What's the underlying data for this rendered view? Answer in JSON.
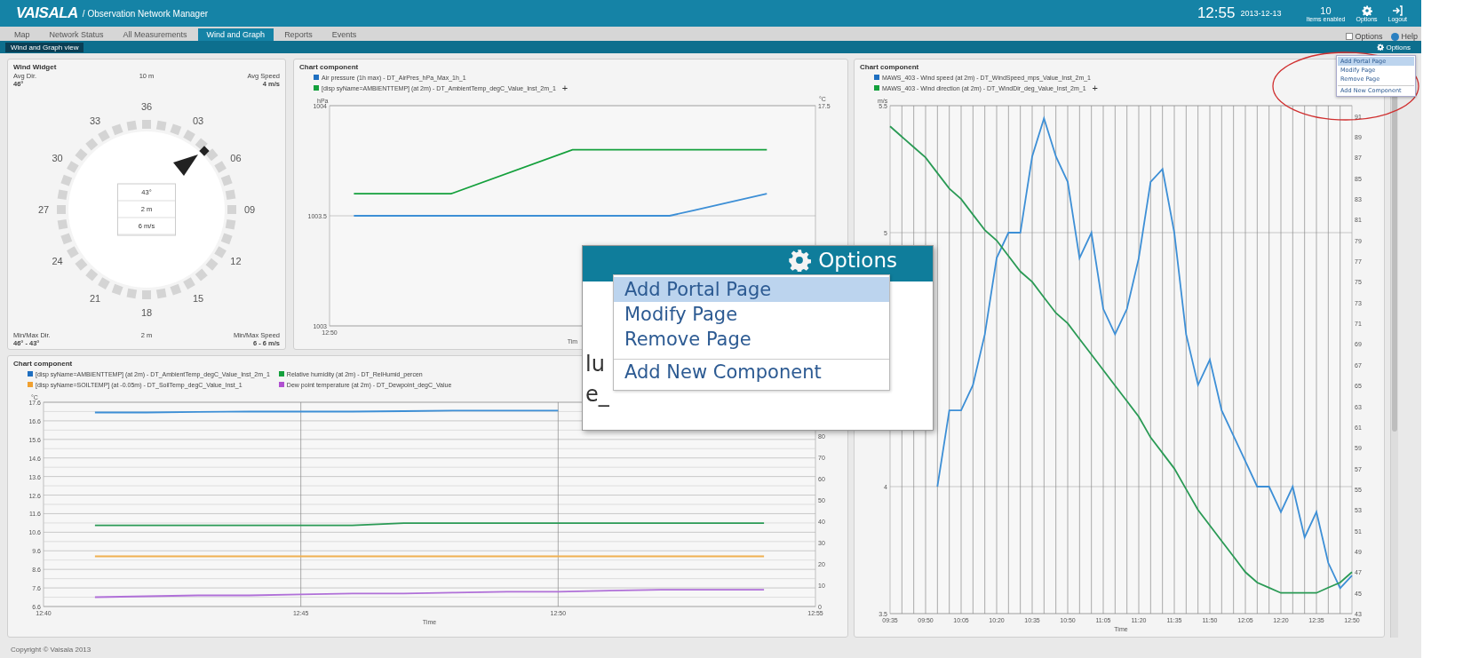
{
  "header": {
    "logo": "VAISALA",
    "app_title": "/ Observation Network Manager",
    "time": "12:55",
    "date": "2013-12-13",
    "actions": [
      {
        "kind": "count",
        "value": "10",
        "label": "Items enabled"
      },
      {
        "kind": "gear",
        "label": "Options"
      },
      {
        "kind": "logout",
        "label": "Logout"
      }
    ]
  },
  "tabs": [
    {
      "label": "Map",
      "selected": false
    },
    {
      "label": "Network Status",
      "selected": false
    },
    {
      "label": "All Measurements",
      "selected": false
    },
    {
      "label": "Wind and Graph",
      "selected": true
    },
    {
      "label": "Reports",
      "selected": false
    },
    {
      "label": "Events",
      "selected": false
    }
  ],
  "tab_links": [
    {
      "kind": "options",
      "label": "Options"
    },
    {
      "kind": "help",
      "label": "Help"
    }
  ],
  "sub_tabs": [
    {
      "label": "Wind and Graph view",
      "selected": true
    }
  ],
  "sub_options": "Options",
  "options_menu": {
    "items": [
      {
        "label": "Add Portal Page",
        "selected": true,
        "separated": false
      },
      {
        "label": "Modify Page",
        "selected": false,
        "separated": false
      },
      {
        "label": "Remove Page",
        "selected": false,
        "separated": false
      },
      {
        "label": "Add New Component",
        "selected": false,
        "separated": true
      }
    ]
  },
  "wind_widget": {
    "title": "Wind Widget",
    "top": {
      "left_label": "Avg Dir.",
      "mid_label": "10 m",
      "right_label": "Avg Speed",
      "left_value": "46°",
      "right_value": "4 m/s"
    },
    "compass": [
      "36",
      "03",
      "06",
      "09",
      "12",
      "15",
      "18",
      "21",
      "24",
      "27",
      "30",
      "33"
    ],
    "center": [
      "43°",
      "2 m",
      "6 m/s"
    ],
    "bottom": {
      "left_label": "Min/Max Dir.",
      "mid_label": "2 m",
      "right_label": "Min/Max Speed",
      "left_value": "46° - 43°",
      "right_value": "6 - 6 m/s"
    }
  },
  "top_chart": {
    "title": "Chart component",
    "add": "+",
    "legend": [
      {
        "color": "#1f6fc0",
        "text": "Air pressure (1h max) - DT_AirPres_hPa_Max_1h_1"
      },
      {
        "color": "#14a03c",
        "text": "[disp syName=AMBIENTTEMP] (at 2m) - DT_AmbientTemp_degC_Value_Inst_2m_1"
      }
    ],
    "right_axis": {
      "unit": "°C",
      "top_label": "17.5"
    },
    "x_start_label": "12:50",
    "chart_data": {
      "type": "line",
      "grid": true,
      "xlabel": "Tim",
      "ylabel": "hPa",
      "ylim": [
        1003,
        1004
      ],
      "yticks": [
        {
          "value": 1003,
          "label": "1003"
        },
        {
          "value": 1003.5,
          "label": "1003.5"
        },
        {
          "value": 1004,
          "label": "1004"
        }
      ],
      "series": [
        {
          "color": "#3d8fd6",
          "values": [
            null,
            1003.5,
            1003.5,
            1003.5,
            1003.5,
            1003.5,
            1003.5,
            1003.5,
            1003.5,
            1003.5,
            1003.5,
            1003.5,
            1003.5,
            1003.5,
            1003.5,
            1003.525,
            1003.55,
            1003.575,
            1003.6,
            null,
            null
          ]
        }
      ]
    }
  },
  "bottom_chart": {
    "title": "Chart component",
    "legend": [
      {
        "color": "#1f6fc0",
        "text": "[disp syName=AMBIENTTEMP] (at 2m) - DT_AmbientTemp_degC_Value_Inst_2m_1"
      },
      {
        "color": "#14a03c",
        "text": "Relative humidity (at 2m) - DT_RelHumid_percen"
      },
      {
        "color": "#f0a030",
        "text": "[disp syName=SOILTEMP] (at -0.05m) - DT_SoilTemp_degC_Value_Inst_1"
      },
      {
        "color": "#b050d0",
        "text": "Dew point temperature (at 2m) - DT_Dewpoint_degC_Value"
      }
    ],
    "chart_data": {
      "type": "line",
      "grid": true,
      "xlabel": "Time",
      "ylabel": "°C",
      "categories": [
        "12:40",
        null,
        null,
        null,
        null,
        "12:45",
        null,
        null,
        null,
        null,
        "12:50",
        null,
        null,
        null,
        null,
        "12:55"
      ],
      "ylim": [
        6.6,
        17.6
      ],
      "yticks": [
        {
          "value": 6.6,
          "label": "6.6"
        },
        {
          "value": 7.6,
          "label": "7.6"
        },
        {
          "value": 8.6,
          "label": "8.6"
        },
        {
          "value": 9.6,
          "label": "9.6"
        },
        {
          "value": 10.6,
          "label": "10.6"
        },
        {
          "value": 11.6,
          "label": "11.6"
        },
        {
          "value": 12.6,
          "label": "12.6"
        },
        {
          "value": 13.6,
          "label": "13.6"
        },
        {
          "value": 14.6,
          "label": "14.6"
        },
        {
          "value": 15.6,
          "label": "15.6"
        },
        {
          "value": 16.6,
          "label": "16.6"
        },
        {
          "value": 17.6,
          "label": "17.6"
        }
      ],
      "y2lim": [
        0,
        95.6
      ],
      "y2ticks": [
        {
          "value": 0,
          "label": "0"
        },
        {
          "value": 10,
          "label": "10"
        },
        {
          "value": 20,
          "label": "20"
        },
        {
          "value": 30,
          "label": "30"
        },
        {
          "value": 40,
          "label": "40"
        },
        {
          "value": 50,
          "label": "50"
        },
        {
          "value": 60,
          "label": "60"
        },
        {
          "value": 70,
          "label": "70"
        },
        {
          "value": 80,
          "label": "80"
        }
      ],
      "series": [
        {
          "color": "#3d8fd6",
          "values": [
            null,
            17.05,
            17.05,
            17.08,
            17.1,
            17.1,
            17.1,
            17.12,
            17.15,
            17.15,
            17.15,
            null,
            null,
            null,
            null,
            null
          ]
        },
        {
          "color": "#2a9a55",
          "axis": "y2",
          "values": [
            null,
            38,
            38,
            38,
            38,
            38,
            38,
            39,
            39,
            39,
            39,
            39,
            39,
            39,
            39,
            null
          ]
        },
        {
          "color": "#f0b050",
          "values": [
            null,
            9.3,
            9.3,
            9.3,
            9.3,
            9.3,
            9.3,
            9.3,
            9.3,
            9.3,
            9.3,
            9.3,
            9.3,
            9.3,
            9.3,
            null
          ]
        },
        {
          "color": "#b070d8",
          "values": [
            null,
            7.1,
            7.15,
            7.2,
            7.2,
            7.25,
            7.3,
            7.3,
            7.35,
            7.4,
            7.4,
            7.45,
            7.5,
            7.5,
            7.5,
            null
          ]
        }
      ]
    }
  },
  "right_chart": {
    "title": "Chart component",
    "add": "+",
    "legend": [
      {
        "color": "#1f6fc0",
        "text": "MAWS_403 - Wind speed (at 2m) - DT_WindSpeed_mps_Value_Inst_2m_1"
      },
      {
        "color": "#14a03c",
        "text": "MAWS_403 - Wind direction (at 2m) - DT_WindDir_deg_Value_Inst_2m_1"
      }
    ],
    "chart_data": {
      "type": "line",
      "grid": true,
      "xlabel": "Time",
      "ylabel": "m/s",
      "categories": [
        "09:35",
        null,
        null,
        "09:50",
        null,
        null,
        "10:05",
        null,
        null,
        "10:20",
        null,
        null,
        "10:35",
        null,
        null,
        "10:50",
        null,
        null,
        "11:05",
        null,
        null,
        "11:20",
        null,
        null,
        "11:35",
        null,
        null,
        "11:50",
        null,
        null,
        "12:05",
        null,
        null,
        "12:20",
        null,
        null,
        "12:35",
        null,
        null,
        "12:50"
      ],
      "ylim": [
        3.5,
        5.5
      ],
      "yticks": [
        {
          "value": 3.5,
          "label": "3.5"
        },
        {
          "value": 4,
          "label": "4"
        },
        {
          "value": 5,
          "label": "5"
        },
        {
          "value": 5.5,
          "label": "5.5"
        }
      ],
      "y2lim": [
        43,
        92
      ],
      "y2ticks": [
        {
          "value": 43,
          "label": "43"
        },
        {
          "value": 45,
          "label": "45"
        },
        {
          "value": 47,
          "label": "47"
        },
        {
          "value": 49,
          "label": "49"
        },
        {
          "value": 51,
          "label": "51"
        },
        {
          "value": 53,
          "label": "53"
        },
        {
          "value": 55,
          "label": "55"
        },
        {
          "value": 57,
          "label": "57"
        },
        {
          "value": 59,
          "label": "59"
        },
        {
          "value": 61,
          "label": "61"
        },
        {
          "value": 63,
          "label": "63"
        },
        {
          "value": 65,
          "label": "65"
        },
        {
          "value": 67,
          "label": "67"
        },
        {
          "value": 69,
          "label": "69"
        },
        {
          "value": 71,
          "label": "71"
        },
        {
          "value": 73,
          "label": "73"
        },
        {
          "value": 75,
          "label": "75"
        },
        {
          "value": 77,
          "label": "77"
        },
        {
          "value": 79,
          "label": "79"
        },
        {
          "value": 81,
          "label": "81"
        },
        {
          "value": 83,
          "label": "83"
        },
        {
          "value": 85,
          "label": "85"
        },
        {
          "value": 87,
          "label": "87"
        },
        {
          "value": 89,
          "label": "89"
        },
        {
          "value": 91,
          "label": "91"
        }
      ],
      "series": [
        {
          "color": "#3d8fd6",
          "values": [
            null,
            null,
            null,
            null,
            4.0,
            4.3,
            4.3,
            4.4,
            4.6,
            4.9,
            5.0,
            5.0,
            5.3,
            5.45,
            5.3,
            5.2,
            4.9,
            5.0,
            4.7,
            4.6,
            4.7,
            4.9,
            5.2,
            5.25,
            5.0,
            4.6,
            4.4,
            4.5,
            4.3,
            4.2,
            4.1,
            4.0,
            4.0,
            3.9,
            4.0,
            3.8,
            3.9,
            3.7,
            3.6,
            3.65
          ]
        },
        {
          "color": "#2a9a55",
          "axis": "y2",
          "values": [
            90,
            89,
            88,
            87,
            85.5,
            84,
            83,
            81.5,
            80,
            79,
            77.5,
            76,
            75,
            73.5,
            72,
            71,
            69.5,
            68,
            66.5,
            65,
            63.5,
            62,
            60,
            58.5,
            57,
            55,
            53,
            51.5,
            50,
            48.5,
            47,
            46,
            45.5,
            45,
            45,
            45,
            45,
            45.5,
            46,
            47
          ]
        }
      ]
    }
  },
  "callout": {
    "title": "Options",
    "fragments": [
      "lu",
      "e_"
    ],
    "items": [
      {
        "label": "Add Portal Page",
        "selected": true,
        "separated": false
      },
      {
        "label": "Modify Page",
        "selected": false,
        "separated": false
      },
      {
        "label": "Remove Page",
        "selected": false,
        "separated": false
      },
      {
        "label": "Add New Component",
        "selected": false,
        "separated": true
      }
    ]
  },
  "footer": "Copyright © Vaisala 2013"
}
